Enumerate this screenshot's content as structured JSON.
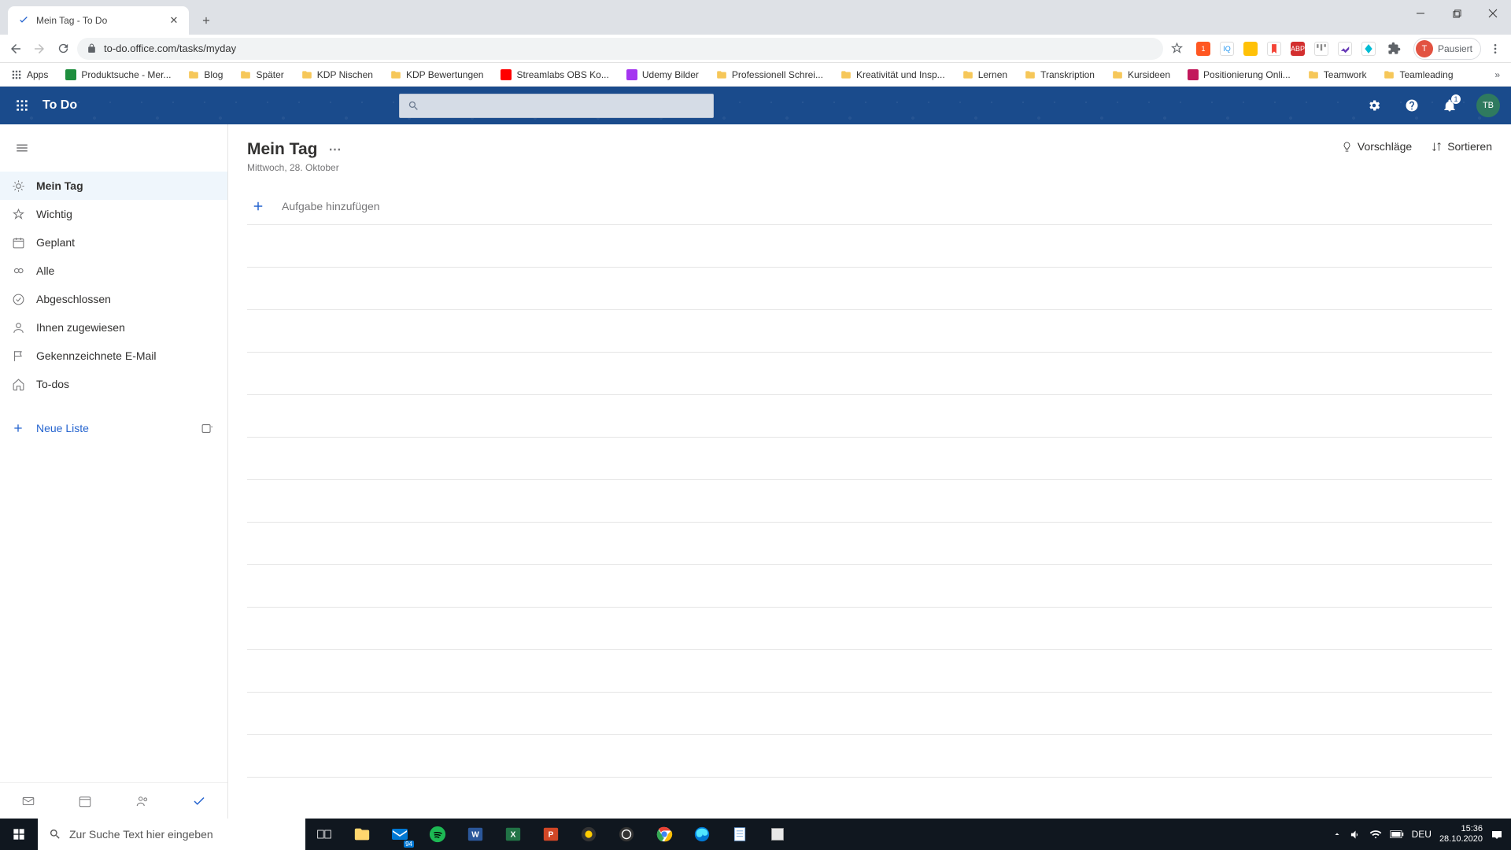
{
  "browser": {
    "tab_title": "Mein Tag - To Do",
    "url": "to-do.office.com/tasks/myday",
    "profile_status": "Pausiert",
    "profile_initial": "T"
  },
  "bookmarks": [
    {
      "label": "Apps",
      "kind": "apps"
    },
    {
      "label": "Produktsuche - Mer...",
      "kind": "icon",
      "color": "#1e8e3e"
    },
    {
      "label": "Blog",
      "kind": "folder"
    },
    {
      "label": "Später",
      "kind": "folder"
    },
    {
      "label": "KDP Nischen",
      "kind": "folder"
    },
    {
      "label": "KDP Bewertungen",
      "kind": "folder"
    },
    {
      "label": "Streamlabs OBS Ko...",
      "kind": "icon",
      "color": "#ff0000"
    },
    {
      "label": "Udemy Bilder",
      "kind": "icon",
      "color": "#a435f0"
    },
    {
      "label": "Professionell Schrei...",
      "kind": "folder"
    },
    {
      "label": "Kreativität und Insp...",
      "kind": "folder"
    },
    {
      "label": "Lernen",
      "kind": "folder"
    },
    {
      "label": "Transkription",
      "kind": "folder"
    },
    {
      "label": "Kursideen",
      "kind": "folder"
    },
    {
      "label": "Positionierung Onli...",
      "kind": "icon",
      "color": "#c2185b"
    },
    {
      "label": "Teamwork",
      "kind": "folder"
    },
    {
      "label": "Teamleading",
      "kind": "folder"
    }
  ],
  "header": {
    "brand": "To Do",
    "avatar_initials": "TB"
  },
  "sidebar": {
    "items": [
      {
        "label": "Mein Tag",
        "icon": "sun",
        "active": true
      },
      {
        "label": "Wichtig",
        "icon": "star"
      },
      {
        "label": "Geplant",
        "icon": "calendar"
      },
      {
        "label": "Alle",
        "icon": "infinity"
      },
      {
        "label": "Abgeschlossen",
        "icon": "check-circle"
      },
      {
        "label": "Ihnen zugewiesen",
        "icon": "person"
      },
      {
        "label": "Gekennzeichnete E-Mail",
        "icon": "flag"
      },
      {
        "label": "To-dos",
        "icon": "home"
      }
    ],
    "new_list": "Neue Liste"
  },
  "page": {
    "title": "Mein Tag",
    "date": "Mittwoch, 28. Oktober",
    "suggestions": "Vorschläge",
    "sort": "Sortieren",
    "add_task": "Aufgabe hinzufügen"
  },
  "taskbar": {
    "search_placeholder": "Zur Suche Text hier eingeben",
    "lang": "DEU",
    "time": "15:36",
    "date": "28.10.2020",
    "mail_badge": "94"
  }
}
